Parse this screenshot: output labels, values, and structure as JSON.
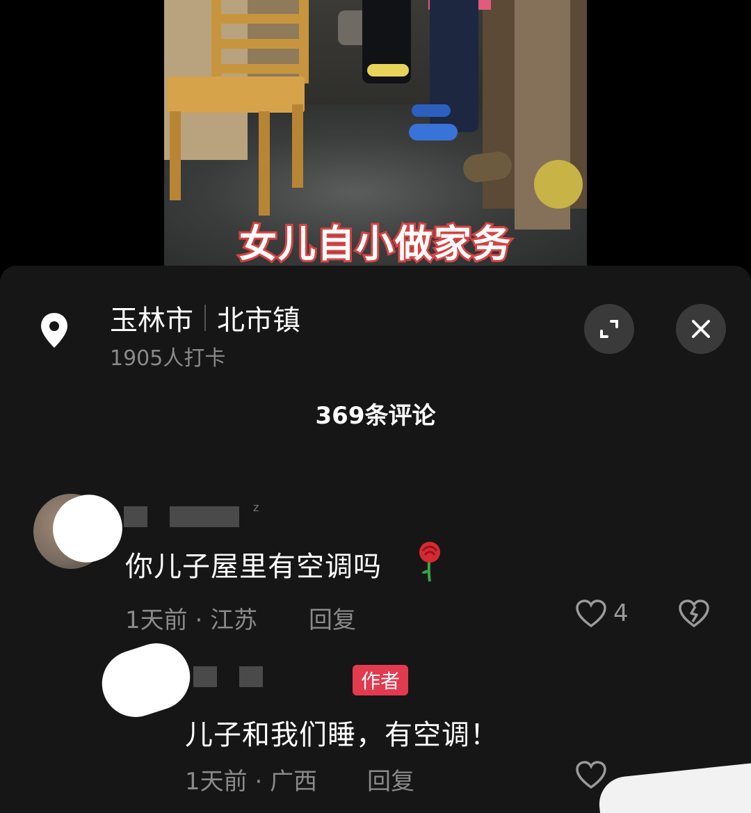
{
  "video": {
    "caption": "女儿自小做家务"
  },
  "location": {
    "city": "玉林市",
    "town": "北市镇",
    "checkins": "1905人打卡"
  },
  "comments_count": "369条评论",
  "comments": [
    {
      "text": "你儿子屋里有空调吗",
      "time": "1天前",
      "region": "江苏",
      "reply_label": "回复",
      "likes": "4",
      "emoji": "rose-icon"
    },
    {
      "badge": "作者",
      "text": "儿子和我们睡，有空调！",
      "time": "1天前",
      "region": "广西",
      "reply_label": "回复"
    }
  ],
  "colors": {
    "sheet_bg": "#161616",
    "author_badge": "#e23a4f",
    "caption_stroke": "#d84242"
  },
  "icons": [
    "location-pin-icon",
    "expand-icon",
    "close-icon",
    "heart-icon",
    "broken-heart-icon",
    "rose-icon"
  ]
}
